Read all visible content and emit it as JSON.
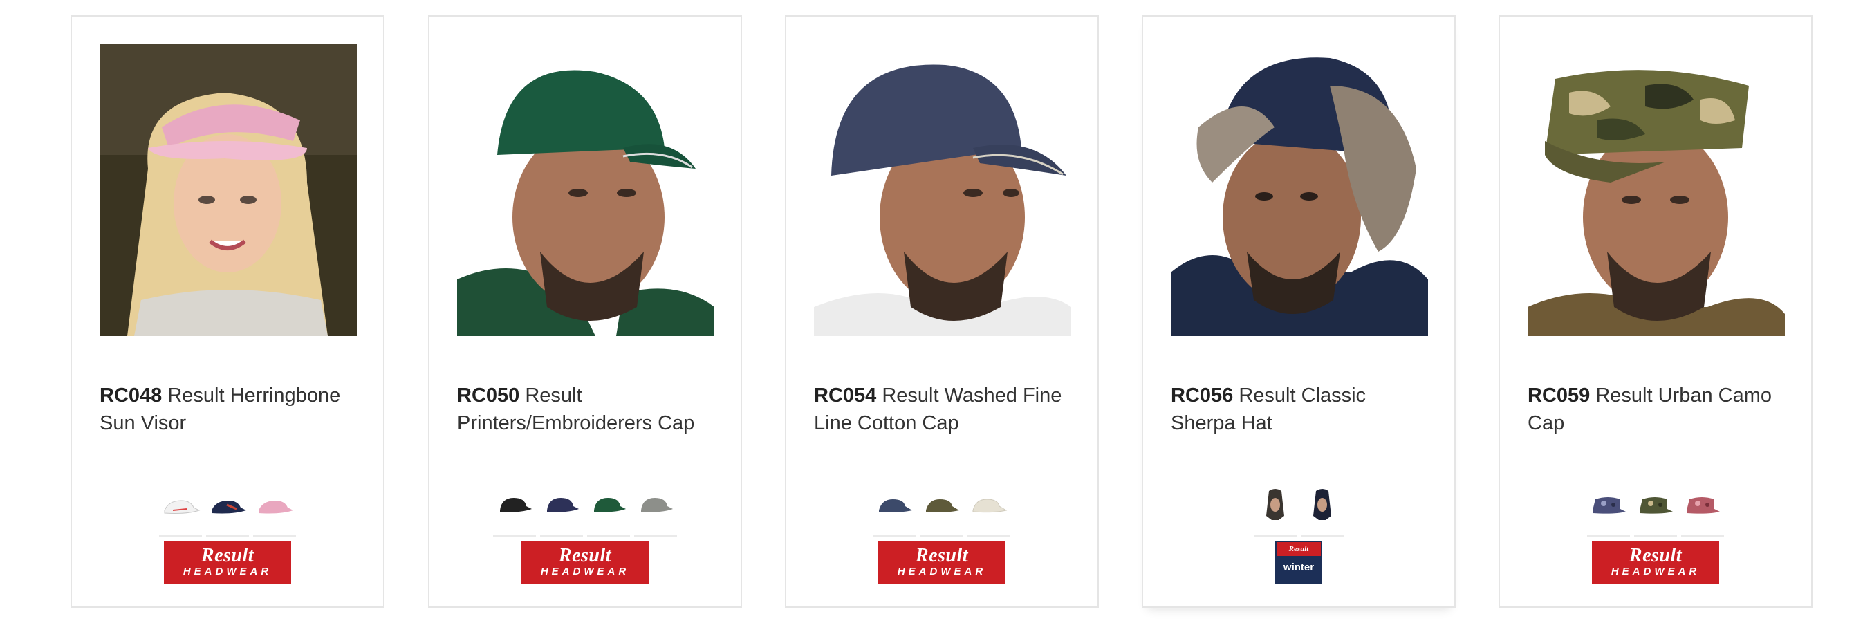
{
  "products": [
    {
      "code": "RC048",
      "name": "Result Herringbone Sun Visor",
      "image_icon": "sun-visor-photo",
      "swatch_colors": [
        "#f2f2f2",
        "#1f2a4e",
        "#e9a7bf"
      ],
      "brand_line1": "Result",
      "brand_line2": "HEADWEAR"
    },
    {
      "code": "RC050",
      "name": "Result Printers/Embroiderers Cap",
      "image_icon": "baseball-cap-photo",
      "swatch_colors": [
        "#222222",
        "#2d3158",
        "#1f5a3a",
        "#8d8f8a"
      ],
      "brand_line1": "Result",
      "brand_line2": "HEADWEAR"
    },
    {
      "code": "RC054",
      "name": "Result Washed Fine Line Cotton Cap",
      "image_icon": "washed-cap-photo",
      "swatch_colors": [
        "#3c4a6a",
        "#5e5a3a",
        "#e6e1d3"
      ],
      "brand_line1": "Result",
      "brand_line2": "HEADWEAR"
    },
    {
      "code": "RC056",
      "name": "Result Classic Sherpa Hat",
      "image_icon": "sherpa-hat-photo",
      "swatch_colors": [
        "#3a3530",
        "#1d2236"
      ],
      "brand_line1": "Result",
      "brand_line2": "winter"
    },
    {
      "code": "RC059",
      "name": "Result Urban Camo Cap",
      "image_icon": "camo-cap-photo",
      "swatch_colors": [
        "#4a4f7a",
        "#4f5635",
        "#b55a66"
      ],
      "brand_line1": "Result",
      "brand_line2": "HEADWEAR"
    }
  ]
}
